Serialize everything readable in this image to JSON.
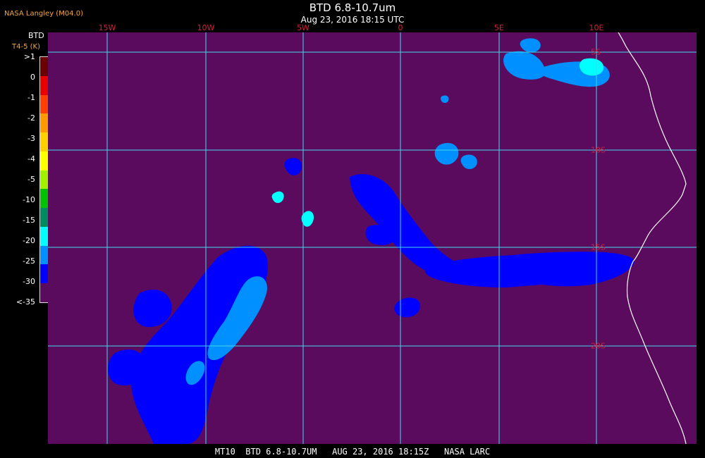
{
  "title": "BTD 6.8-10.7um",
  "subtitle": "Aug 23, 2016 18:15 UTC",
  "source": "NASA Langley (M04.0)",
  "legend": {
    "title": "BTD",
    "units": "T4-5 (K)",
    "labels": [
      ">1",
      "0",
      "-1",
      "-2",
      "-3",
      "-4",
      "-5",
      "-10",
      "-15",
      "-20",
      "-25",
      "-30",
      "<-35"
    ],
    "colors": [
      "#6b0000",
      "#e80000",
      "#ff4000",
      "#ff9a00",
      "#ffd000",
      "#ffff00",
      "#a0f000",
      "#00c000",
      "#008a60",
      "#00ffff",
      "#0090ff",
      "#0000ff",
      "#5b0b5e"
    ]
  },
  "grid": {
    "lon_labels": [
      "15W",
      "10W",
      "5W",
      "0",
      "5E",
      "10E"
    ],
    "lat_labels": [
      "5S",
      "10S",
      "15S",
      "20S"
    ]
  },
  "colors": {
    "background": "#5b0b5e",
    "grid": "#40d8e8",
    "coastline": "#ffffff",
    "cloud_deep": "#0000ff",
    "cloud_mid": "#0090ff",
    "cloud_light": "#00ffff"
  },
  "footer": "MT10  BTD 6.8-10.7UM   AUG 23, 2016 18:15Z   NASA LARC"
}
